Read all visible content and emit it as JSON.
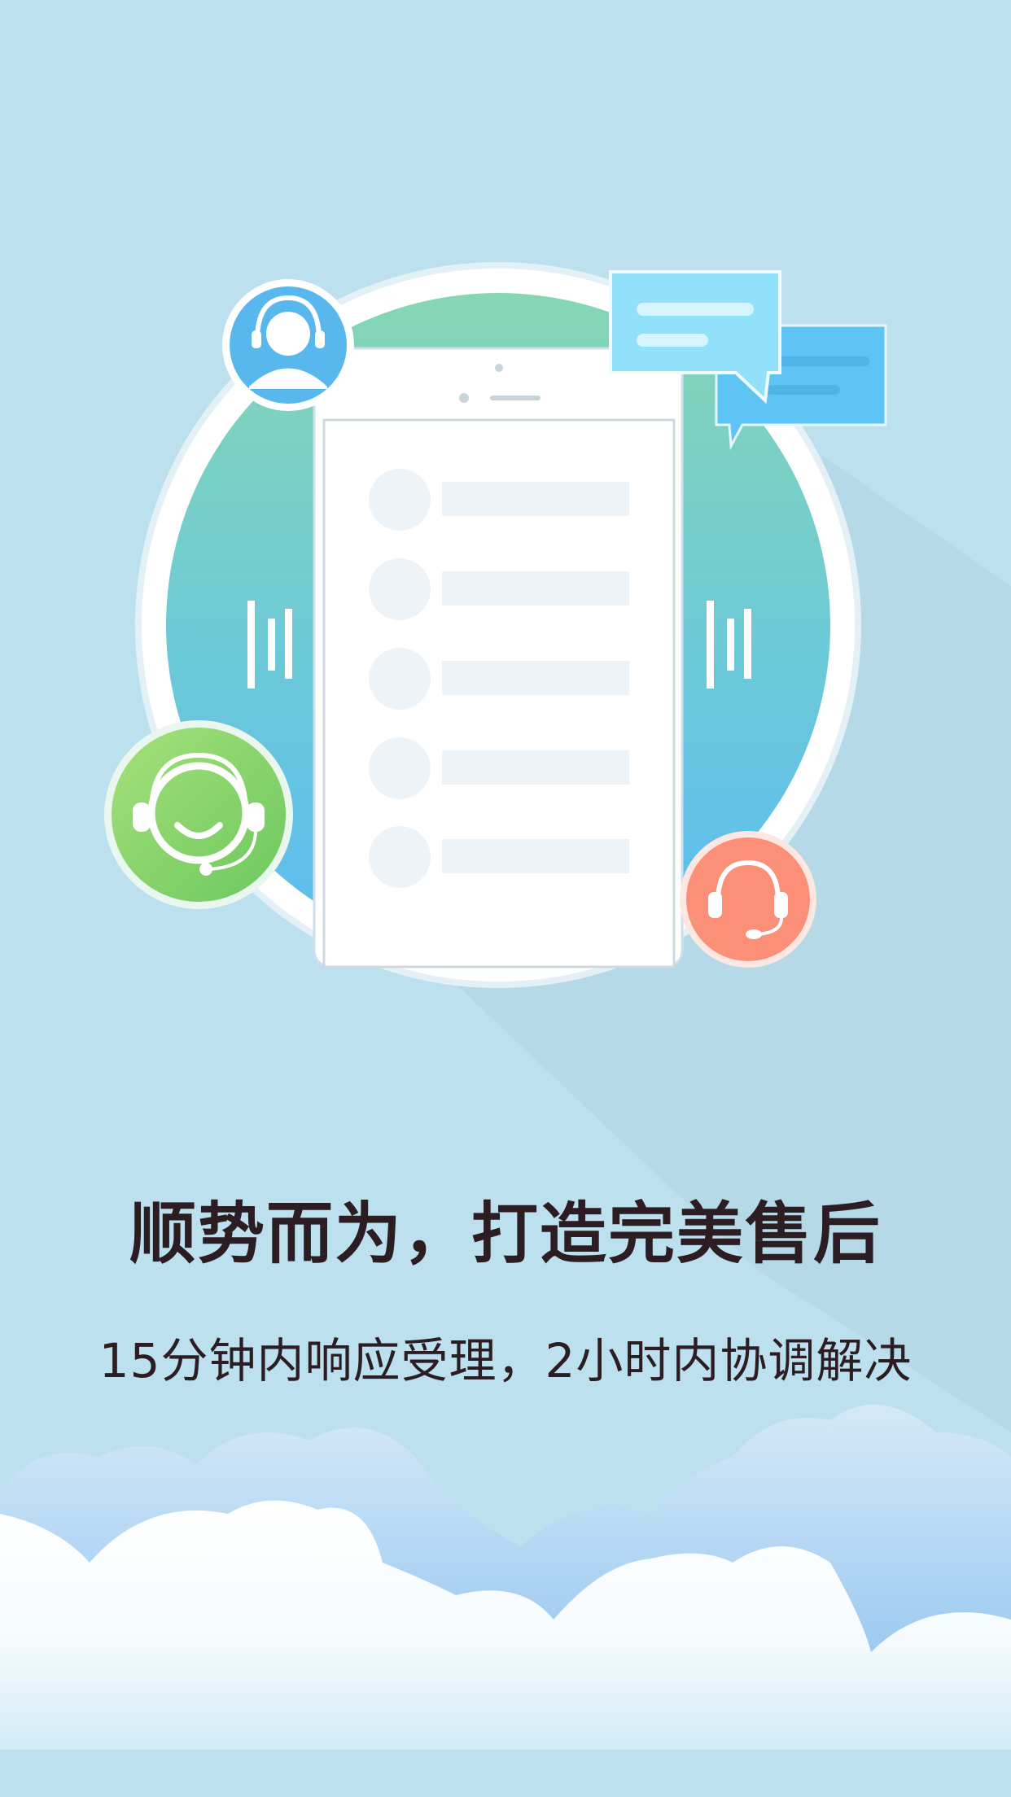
{
  "splash": {
    "headline": "顺势而为，打造完美售后",
    "subline": "15分钟内响应受理，2小时内协调解决"
  },
  "illustration": {
    "icons": [
      "user-headset-icon",
      "chat-bubbles-icon",
      "smiling-support-icon",
      "headphones-icon",
      "sound-wave-icon"
    ],
    "colors": {
      "background": "#bde0ee",
      "circle_top": "#86d6b4",
      "circle_bottom": "#5bbcf2",
      "user_badge": "#58b8ee",
      "support_badge": "#8ed56f",
      "headphones_badge": "#fb8f78",
      "chat_light": "#92e1fb",
      "chat_dark": "#5ec4f4",
      "text": "#2b1d22"
    }
  }
}
